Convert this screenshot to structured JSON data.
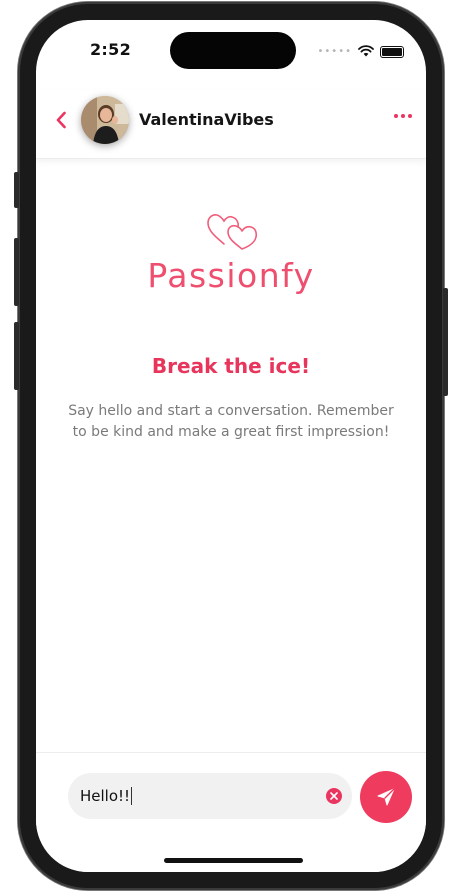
{
  "status_bar": {
    "time": "2:52",
    "signal_icon": "signal-dots-icon",
    "wifi_icon": "wifi-icon",
    "battery_icon": "battery-icon"
  },
  "header": {
    "username": "ValentinaVibes",
    "back_icon": "chevron-left-icon",
    "more_icon": "more-dots-icon"
  },
  "empty_state": {
    "brand_name": "Passionfy",
    "title": "Break the ice!",
    "subtitle": "Say hello and start a conversation. Remember to be kind and make a great first impression!"
  },
  "composer": {
    "message_value": "Hello!!",
    "clear_icon": "clear-icon",
    "send_icon": "send-icon"
  },
  "colors": {
    "accent": "#ea3560",
    "brand_text": "#ef4f6e",
    "muted_text": "#7a7a7a"
  }
}
